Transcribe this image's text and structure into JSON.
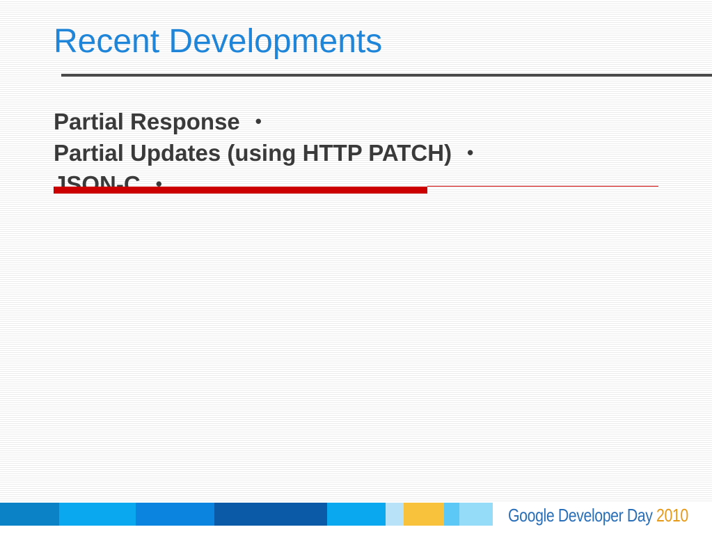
{
  "slide": {
    "title": "Recent Developments",
    "bullets": [
      {
        "text": "Partial Response",
        "marker": "•"
      },
      {
        "text": "Partial Updates (using HTTP PATCH)",
        "marker": "•"
      },
      {
        "text": "JSON-C",
        "marker": "•"
      }
    ]
  },
  "footer": {
    "logo_google": "Google",
    "logo_event": "Developer Day",
    "logo_year": "2010",
    "stripe_colors": [
      "#0b82c6",
      "#0aa9ef",
      "#0a84de",
      "#0a5aa8",
      "#0aa9ef",
      "#b7e2f8",
      "#f9c23c",
      "#5cc8f5",
      "#95dcf9"
    ]
  },
  "colors": {
    "title": "#1f85d8",
    "accent_red": "#cc0000",
    "rule": "#4a4a4a"
  }
}
